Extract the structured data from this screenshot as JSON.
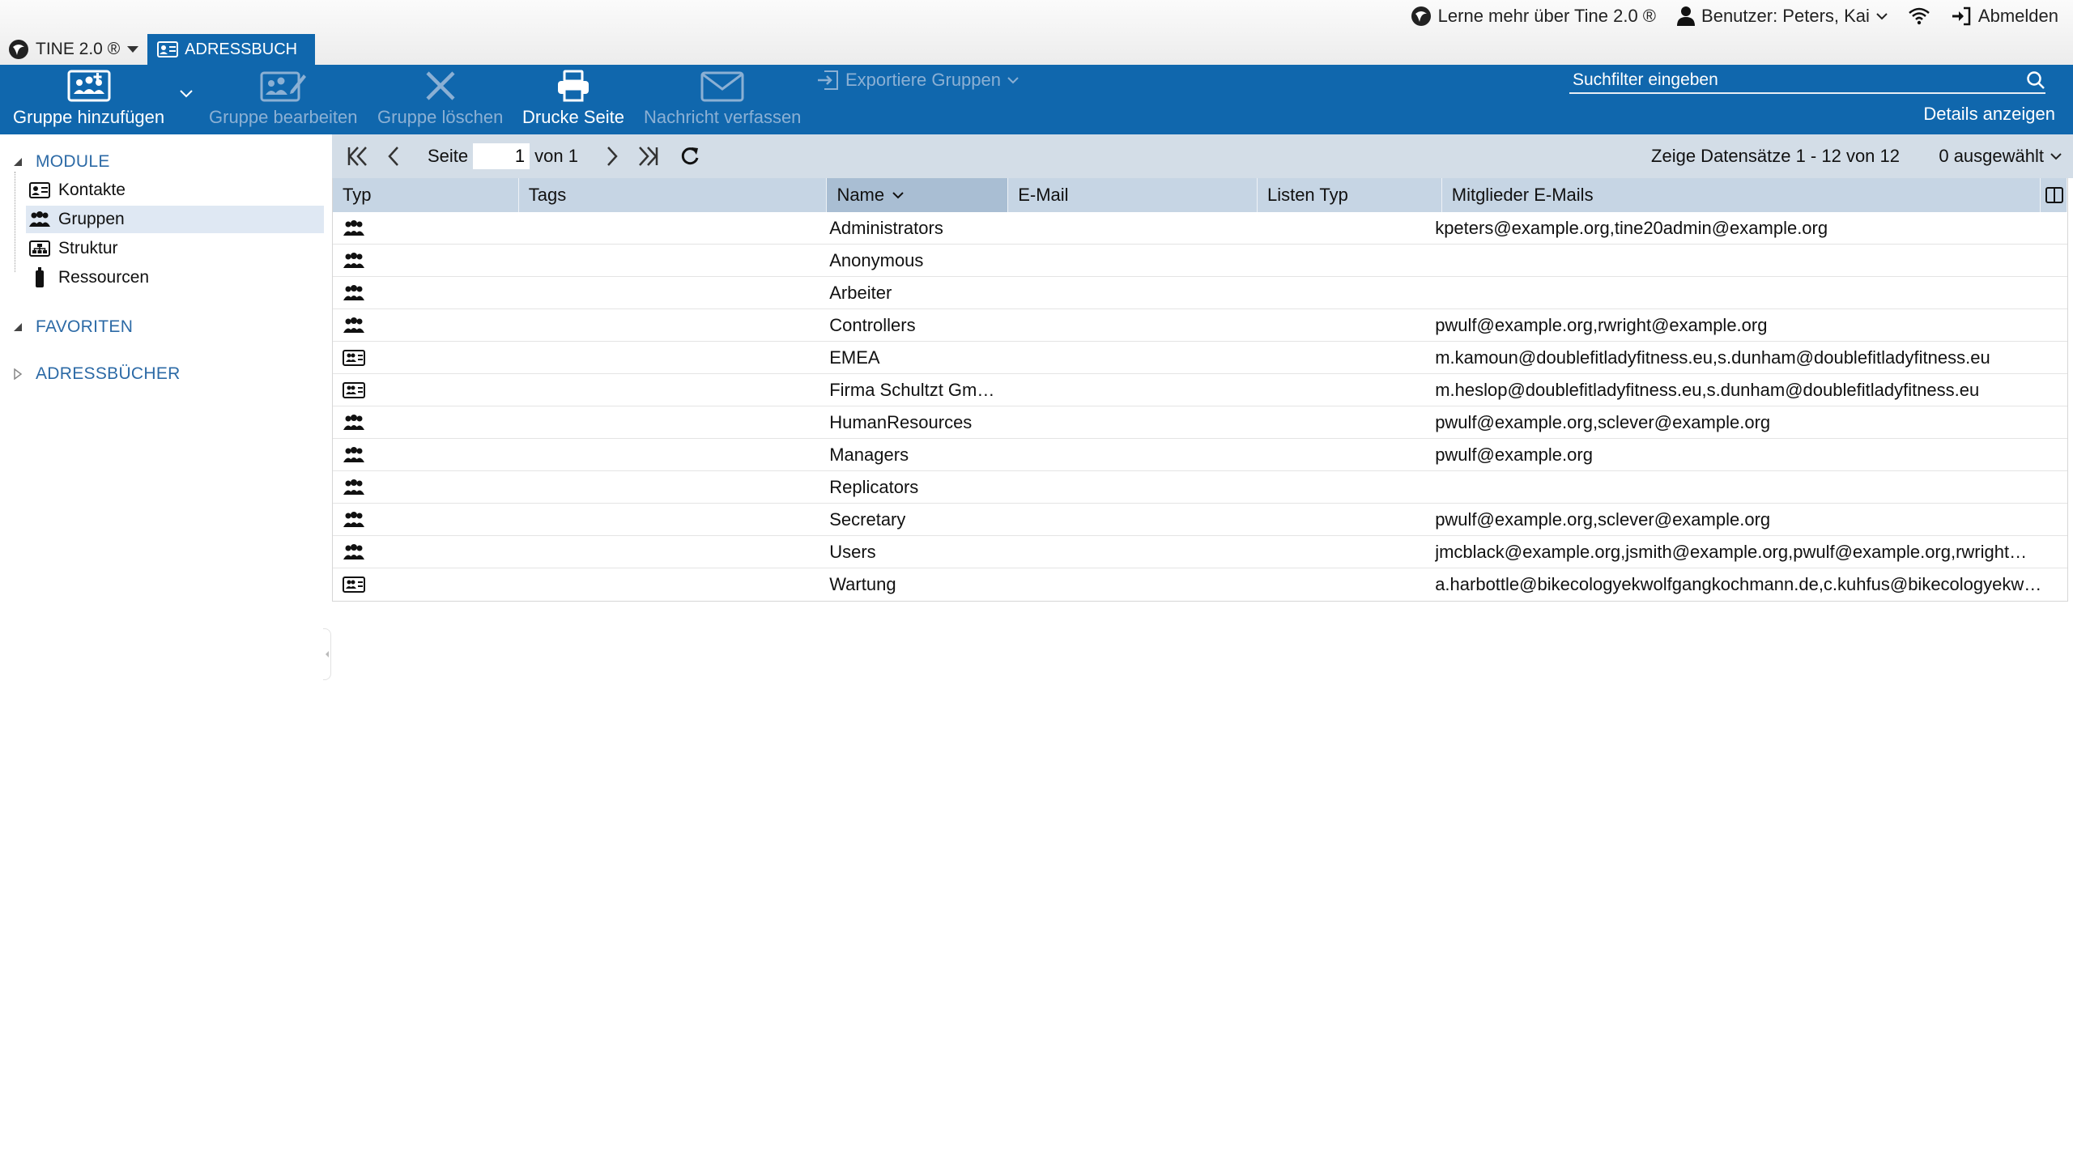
{
  "top": {
    "learn_more": "Lerne mehr über Tine 2.0 ®",
    "user": "Benutzer: Peters, Kai",
    "logout": "Abmelden"
  },
  "tabs": {
    "app_menu": "TINE 2.0 ®",
    "active_tab": "ADRESSBUCH"
  },
  "toolbar": {
    "add_group": "Gruppe hinzufügen",
    "edit_group": "Gruppe bearbeiten",
    "delete_group": "Gruppe löschen",
    "print_page": "Drucke Seite",
    "compose_message": "Nachricht verfassen",
    "export_groups": "Exportiere Gruppen",
    "search_placeholder": "Suchfilter eingeben",
    "details": "Details anzeigen"
  },
  "sidebar": {
    "modules_header": "MODULE",
    "items": [
      {
        "label": "Kontakte",
        "icon": "contact-card-icon"
      },
      {
        "label": "Gruppen",
        "icon": "group-icon"
      },
      {
        "label": "Struktur",
        "icon": "structure-icon"
      },
      {
        "label": "Ressourcen",
        "icon": "resource-icon"
      }
    ],
    "favorites_header": "FAVORITEN",
    "addressbooks_header": "ADRESSBÜCHER"
  },
  "pager": {
    "page_label": "Seite",
    "page_value": "1",
    "of_label": "von 1",
    "info": "Zeige Datensätze 1 - 12 von 12",
    "selected": "0 ausgewählt"
  },
  "grid": {
    "columns": [
      "Typ",
      "Tags",
      "Name",
      "E-Mail",
      "Listen Typ",
      "Mitglieder E-Mails"
    ],
    "sorted_column": "Name",
    "rows": [
      {
        "type": "group",
        "name": "Administrators",
        "email": "",
        "list_type": "",
        "members": "kpeters@example.org,tine20admin@example.org"
      },
      {
        "type": "group",
        "name": "Anonymous",
        "email": "",
        "list_type": "",
        "members": ""
      },
      {
        "type": "group",
        "name": "Arbeiter",
        "email": "",
        "list_type": "",
        "members": ""
      },
      {
        "type": "group",
        "name": "Controllers",
        "email": "",
        "list_type": "",
        "members": "pwulf@example.org,rwright@example.org"
      },
      {
        "type": "list",
        "name": "EMEA",
        "email": "",
        "list_type": "",
        "members": "m.kamoun@doublefitladyfitness.eu,s.dunham@doublefitladyfitness.eu"
      },
      {
        "type": "list",
        "name": "Firma Schultzt Gm…",
        "email": "",
        "list_type": "",
        "members": "m.heslop@doublefitladyfitness.eu,s.dunham@doublefitladyfitness.eu"
      },
      {
        "type": "group",
        "name": "HumanResources",
        "email": "",
        "list_type": "",
        "members": "pwulf@example.org,sclever@example.org"
      },
      {
        "type": "group",
        "name": "Managers",
        "email": "",
        "list_type": "",
        "members": "pwulf@example.org"
      },
      {
        "type": "group",
        "name": "Replicators",
        "email": "",
        "list_type": "",
        "members": ""
      },
      {
        "type": "group",
        "name": "Secretary",
        "email": "",
        "list_type": "",
        "members": "pwulf@example.org,sclever@example.org"
      },
      {
        "type": "group",
        "name": "Users",
        "email": "",
        "list_type": "",
        "members": "jmcblack@example.org,jsmith@example.org,pwulf@example.org,rwright…"
      },
      {
        "type": "list",
        "name": "Wartung",
        "email": "",
        "list_type": "",
        "members": "a.harbottle@bikecologyekwolfgangkochmann.de,c.kuhfus@bikecologyekw…"
      }
    ]
  },
  "colors": {
    "brand_blue": "#1067ad",
    "disabled_text": "#8bb0d4",
    "grid_header": "#c6d5e4",
    "pager_bg": "#d3dde7",
    "sidebar_link": "#2c6aa6"
  }
}
